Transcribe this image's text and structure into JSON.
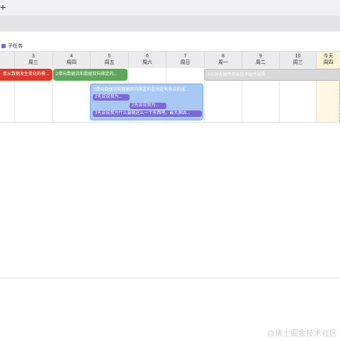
{
  "toolbar": {
    "plus_glyph": "+"
  },
  "legend": {
    "label": "子任务",
    "color": "#7a6ad8"
  },
  "columns": [
    {
      "day": "3",
      "weekday": "周三",
      "today": false
    },
    {
      "day": "4",
      "weekday": "周四",
      "today": false
    },
    {
      "day": "5",
      "weekday": "周五",
      "today": false
    },
    {
      "day": "6",
      "weekday": "周六",
      "today": false
    },
    {
      "day": "7",
      "weekday": "周日",
      "today": false
    },
    {
      "day": "8",
      "weekday": "周一",
      "today": false
    },
    {
      "day": "9",
      "weekday": "周二",
      "today": false
    },
    {
      "day": "10",
      "weekday": "周三",
      "today": false
    },
    {
      "day": "今天",
      "weekday": "周四",
      "today": true
    }
  ],
  "tasks": {
    "red": {
      "label": "意从数据发生变化的模...",
      "color": "#d93a2b"
    },
    "green": {
      "label": "2单向数据流和数据双向绑定的...",
      "color": "#5fa65b"
    },
    "grey": {
      "label": "4元洲南做件开始任子组件退需",
      "color": "#d8d8d8"
    },
    "group": {
      "title": "3单向数据流和数据双向绑定的区别还有各自的优...",
      "color": "#a9c9f4",
      "subtasks": [
        {
          "label": "2先说说我为..."
        },
        {
          "label": "2先说说我为..."
        },
        {
          "label": "3先说说我为什么要做这么一个东西吧。最大原因..."
        }
      ]
    }
  },
  "watermark": "@稀土掘金技术社区"
}
